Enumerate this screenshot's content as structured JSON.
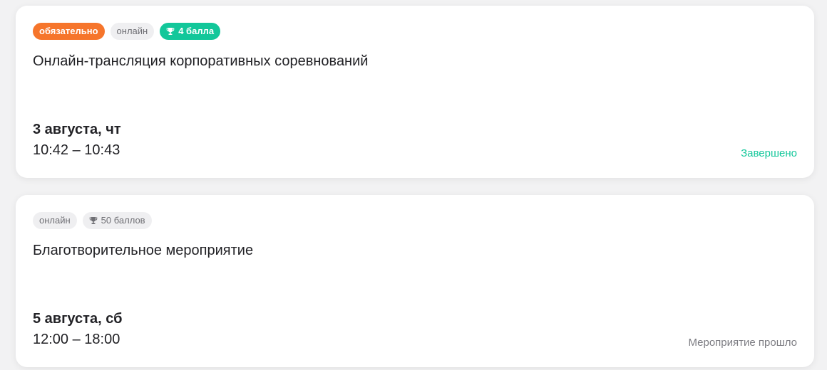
{
  "events": [
    {
      "tags": {
        "mandatory": "обязательно",
        "format": "онлайн",
        "points": "4 балла"
      },
      "title": "Онлайн-трансляция корпоративных соревнований",
      "date": "3 августа, чт",
      "time": "10:42 – 10:43",
      "status": "Завершено"
    },
    {
      "tags": {
        "format": "онлайн",
        "points": "50 баллов"
      },
      "title": "Благотворительное мероприятие",
      "date": "5 августа, сб",
      "time": "12:00 – 18:00",
      "status": "Мероприятие прошло"
    }
  ],
  "colors": {
    "mandatory": "#f6752b",
    "accent_green": "#12c79a",
    "tag_neutral_bg": "#efeff1",
    "muted_text": "#7c7c82"
  },
  "icons": {
    "points": "trophy-icon"
  }
}
